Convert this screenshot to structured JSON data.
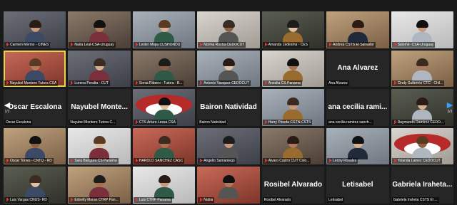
{
  "navigation": {
    "prev_page": "1/3",
    "next_page": "3/3"
  },
  "colors": {
    "active_speaker": "#e6d64a",
    "muted_mic": "#e03a3a"
  },
  "tiles": [
    {
      "name": "Carmen Merino - CINES",
      "muted": true,
      "video": true,
      "big": ""
    },
    {
      "name": "Naira Leal-CSA-Uruguay",
      "muted": true,
      "video": true,
      "big": ""
    },
    {
      "name": "Lester Mejia CUSHONDU",
      "muted": true,
      "video": true,
      "big": ""
    },
    {
      "name": "Norma Rocha CEDOCUT",
      "muted": true,
      "video": true,
      "big": ""
    },
    {
      "name": "Amanda Ledesma - CES",
      "muted": true,
      "video": true,
      "big": ""
    },
    {
      "name": "Andrea CSTS El Salvador",
      "muted": true,
      "video": true,
      "big": ""
    },
    {
      "name": "Salomé -CSA-Uruguay",
      "muted": true,
      "video": true,
      "big": ""
    },
    {
      "name": "Nayubel Montero Tutora CSA",
      "muted": true,
      "video": true,
      "big": "",
      "active": true
    },
    {
      "name": "Lorena Peralta - CUT",
      "muted": true,
      "video": true,
      "big": ""
    },
    {
      "name": "Sonia Ribeiro - Tutora - B...",
      "muted": true,
      "video": true,
      "big": ""
    },
    {
      "name": "Antonio Vasquez CEDOCUT",
      "muted": true,
      "video": true,
      "big": ""
    },
    {
      "name": "Aneska CS Panama",
      "muted": true,
      "video": true,
      "big": ""
    },
    {
      "name": "Ana Alvarez",
      "muted": false,
      "video": false,
      "big": "Ana Alvarez"
    },
    {
      "name": "Cindy Gutierrez CTC - Chil...",
      "muted": true,
      "video": true,
      "big": ""
    },
    {
      "name": "Oscar Escalona",
      "muted": false,
      "video": false,
      "big": "Oscar Escalona"
    },
    {
      "name": "Nayubel Montero Tutora C...",
      "muted": false,
      "video": false,
      "big": "Nayubel Monte..."
    },
    {
      "name": "CTS Arturo Lessa CSA",
      "muted": true,
      "video": true,
      "big": "",
      "banner": true
    },
    {
      "name": "Bairon Natividad",
      "muted": false,
      "video": false,
      "big": "Bairon Natividad"
    },
    {
      "name": "Harry Pineda CGTN-CSTS",
      "muted": true,
      "video": true,
      "big": ""
    },
    {
      "name": "ana cecilia ramirez sanch...",
      "muted": false,
      "video": false,
      "big": "ana cecilia rami..."
    },
    {
      "name": "Raymundo Ramírez CEDO...",
      "muted": true,
      "video": true,
      "big": ""
    },
    {
      "name": "Oscar Torres - CNTQ - RD",
      "muted": true,
      "video": true,
      "big": ""
    },
    {
      "name": "Sara Bangura CS Panama",
      "muted": true,
      "video": true,
      "big": ""
    },
    {
      "name": "HAROLD SANCHEZ CASC",
      "muted": true,
      "video": true,
      "big": ""
    },
    {
      "name": "Angello Samaniego",
      "muted": true,
      "video": true,
      "big": ""
    },
    {
      "name": "Alvaro Castro CUT Colo...",
      "muted": true,
      "video": true,
      "big": ""
    },
    {
      "name": "Lenny Rosales",
      "muted": true,
      "video": true,
      "big": ""
    },
    {
      "name": "Yolanda Lainez CEDOCUT",
      "muted": true,
      "video": true,
      "big": "",
      "banner": true
    },
    {
      "name": "Luis Vargas CNUS- RD",
      "muted": true,
      "video": true,
      "big": ""
    },
    {
      "name": "Ednelly Moran CTRP Pan...",
      "muted": true,
      "video": true,
      "big": ""
    },
    {
      "name": "Luis CTRP Panama",
      "muted": true,
      "video": true,
      "big": ""
    },
    {
      "name": "Nubia",
      "muted": true,
      "video": true,
      "big": ""
    },
    {
      "name": "Rosibel Alvarado",
      "muted": false,
      "video": false,
      "big": "Rosibel Alvarado"
    },
    {
      "name": "Letisabel",
      "muted": false,
      "video": false,
      "big": "Letisabel"
    },
    {
      "name": "Gabriela Iraheta CSTS El ...",
      "muted": false,
      "video": false,
      "big": "Gabriela Iraheta..."
    }
  ]
}
